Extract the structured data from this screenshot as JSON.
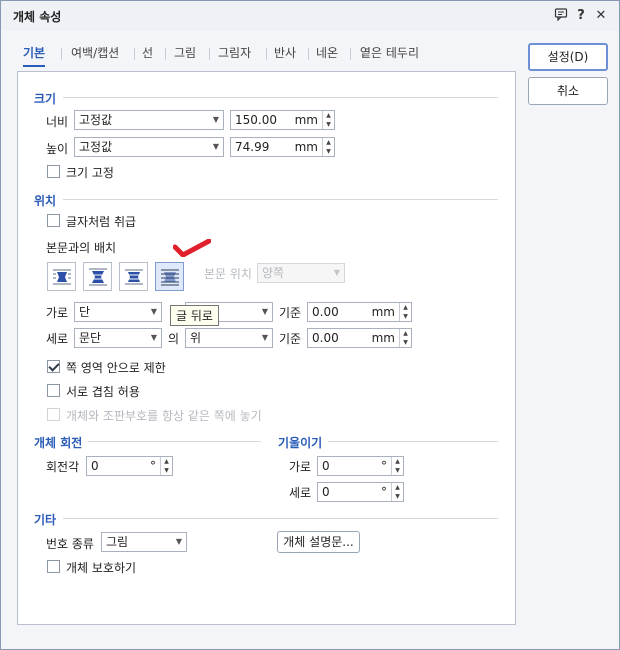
{
  "window": {
    "title": "개체 속성"
  },
  "titlebar": {
    "comment_icon": "comment-icon",
    "help": "?",
    "close": "✕"
  },
  "tabs": [
    "기본",
    "여백/캡션",
    "선",
    "그림",
    "그림자",
    "반사",
    "네온",
    "옅은 테두리"
  ],
  "buttons": {
    "ok": "설정(D)",
    "cancel": "취소",
    "description": "개체 설명문..."
  },
  "size": {
    "title": "크기",
    "width_label": "너비",
    "width_mode": "고정값",
    "width_value": "150.00",
    "width_unit": "mm",
    "height_label": "높이",
    "height_mode": "고정값",
    "height_value": "74.99",
    "height_unit": "mm",
    "fix_size": "크기 고정"
  },
  "position": {
    "title": "위치",
    "treat_as_char": "글자처럼 취급",
    "wrap_title": "본문과의 배치",
    "text_pos_label": "본문 위치",
    "text_pos_value": "양쪽",
    "tooltip": "글 뒤로",
    "horz_label": "가로",
    "horz_mode": "단",
    "horz_ref_label": "기준",
    "horz_value": "0.00",
    "horz_unit": "mm",
    "vert_label": "세로",
    "vert_mode": "문단",
    "vert_of": "의",
    "vert_ref": "위",
    "vert_ref_label": "기준",
    "vert_value": "0.00",
    "vert_unit": "mm",
    "limit_page": "쪽 영역 안으로 제한",
    "limit_page_checked": true,
    "allow_overlap": "서로 겹침 허용",
    "keep_same_page": "개체와 조판부호를 항상 같은 쪽에 놓기",
    "wrap_options": [
      "wrap-square-icon",
      "wrap-top-bottom-icon",
      "wrap-behind-text-icon",
      "wrap-in-front-of-text-icon"
    ]
  },
  "rotation": {
    "title": "개체 회전",
    "angle_label": "회전각",
    "angle_value": "0",
    "angle_unit": "°"
  },
  "skew": {
    "title": "기울이기",
    "horz_label": "가로",
    "horz_value": "0",
    "vert_label": "세로",
    "vert_value": "0",
    "unit": "°"
  },
  "etc": {
    "title": "기타",
    "number_type_label": "번호 종류",
    "number_type_value": "그림",
    "protect": "개체 보호하기"
  },
  "colors": {
    "accent": "#2b5cb8",
    "check_mark": "#e0202a"
  }
}
